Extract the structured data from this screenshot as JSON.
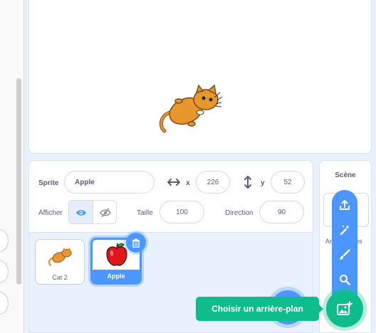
{
  "sprite_info": {
    "sprite_label": "Sprite",
    "sprite_name": "Apple",
    "x_label": "x",
    "x_value": "226",
    "y_label": "y",
    "y_value": "52",
    "show_label": "Afficher",
    "size_label": "Taille",
    "size_value": "100",
    "direction_label": "Direction",
    "direction_value": "90"
  },
  "sprites": [
    {
      "name": "Cat 2",
      "selected": false
    },
    {
      "name": "Apple",
      "selected": true
    }
  ],
  "stage_pane": {
    "title": "Scène",
    "partial_text": "Arrière-plans"
  },
  "backdrop_menu": {
    "tooltip": "Choisir un arrière-plan",
    "items": [
      "upload-icon",
      "surprise-icon",
      "paint-icon",
      "search-icon"
    ]
  },
  "colors": {
    "accent": "#4c97ff",
    "backdrop_button": "#0fbd8c",
    "cat_orange": "#e8962e",
    "apple_red": "#e3151b"
  }
}
